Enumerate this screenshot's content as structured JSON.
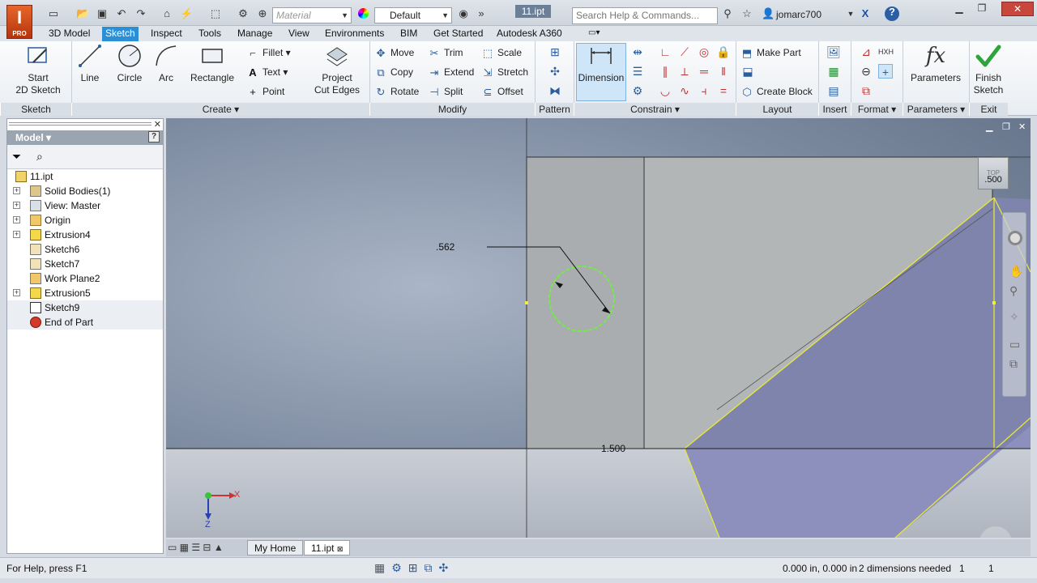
{
  "app": {
    "logo_letter": "I",
    "logo_sub": "PRO",
    "doc_title": "11.ipt"
  },
  "quick_access": {
    "material": "Material",
    "appearance": "Default"
  },
  "search": {
    "placeholder": "Search Help & Commands..."
  },
  "user": {
    "name": "jomarc700"
  },
  "tabs": [
    "3D Model",
    "Sketch",
    "Inspect",
    "Tools",
    "Manage",
    "View",
    "Environments",
    "BIM",
    "Get Started",
    "Autodesk A360"
  ],
  "active_tab": "Sketch",
  "ribbon": {
    "groups": [
      "Sketch",
      "Create",
      "Modify",
      "Pattern",
      "Constrain",
      "Layout",
      "Insert",
      "Format",
      "Parameters",
      "Exit"
    ],
    "start_sketch": {
      "line1": "Start",
      "line2": "2D Sketch"
    },
    "line": "Line",
    "circle": "Circle",
    "arc": "Arc",
    "rectangle": "Rectangle",
    "fillet": "Fillet",
    "text": "Text",
    "point": "Point",
    "project_cut_edges": {
      "line1": "Project",
      "line2": "Cut Edges"
    },
    "move": "Move",
    "copy": "Copy",
    "rotate": "Rotate",
    "trim": "Trim",
    "extend": "Extend",
    "split": "Split",
    "scale": "Scale",
    "stretch": "Stretch",
    "offset": "Offset",
    "dimension": "Dimension",
    "make_part": "Make Part",
    "create_block": "Create Block",
    "parameters": "Parameters",
    "finish_sketch": {
      "line1": "Finish",
      "line2": "Sketch"
    }
  },
  "browser": {
    "title": "Model",
    "root": "11.ipt",
    "nodes": [
      {
        "label": "Solid Bodies(1)",
        "expandable": true
      },
      {
        "label": "View: Master",
        "expandable": true
      },
      {
        "label": "Origin",
        "expandable": true
      },
      {
        "label": "Extrusion4",
        "expandable": true
      },
      {
        "label": "Sketch6",
        "expandable": false
      },
      {
        "label": "Sketch7",
        "expandable": false
      },
      {
        "label": "Work Plane2",
        "expandable": false
      },
      {
        "label": "Extrusion5",
        "expandable": true
      },
      {
        "label": "Sketch9",
        "expandable": false
      },
      {
        "label": "End of Part",
        "expandable": false
      }
    ]
  },
  "viewport": {
    "dim_diameter": ".562",
    "dim_horizontal": "1.500",
    "dim_right": ".500",
    "viewcube_label": "TOP",
    "axis_x": "X",
    "axis_z": "Z"
  },
  "doc_tabs": [
    "My Home",
    "11.ipt"
  ],
  "status": {
    "help": "For Help, press F1",
    "coords": "0.000 in, 0.000 in",
    "dims_needed": "2 dimensions needed",
    "count1": "1",
    "count2": "1"
  }
}
